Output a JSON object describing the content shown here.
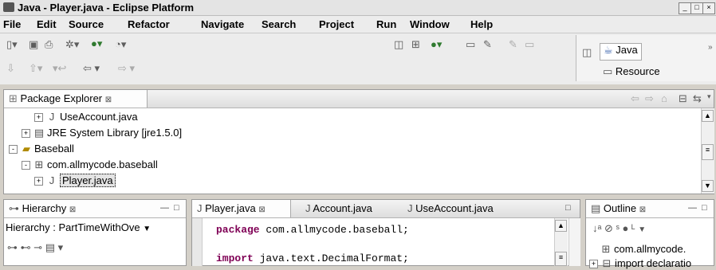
{
  "window": {
    "title": "Java - Player.java - Eclipse Platform"
  },
  "menu": [
    "File",
    "Edit",
    "Source",
    "Refactor",
    "Navigate",
    "Search",
    "Project",
    "Run",
    "Window",
    "Help"
  ],
  "perspectives": {
    "java": "Java",
    "resource": "Resource"
  },
  "package_explorer": {
    "tab": "Package Explorer",
    "tree": [
      {
        "label": "UseAccount.java",
        "expander": "+",
        "icon": "java-file-icon"
      },
      {
        "label": "JRE System Library [jre1.5.0]",
        "expander": "+",
        "icon": "library-icon"
      },
      {
        "label": "Baseball",
        "expander": "-",
        "icon": "project-folder-icon"
      },
      {
        "label": "com.allmycode.baseball",
        "expander": "-",
        "icon": "package-icon"
      },
      {
        "label": "Player.java",
        "expander": "+",
        "icon": "java-file-icon",
        "selected": true
      }
    ]
  },
  "hierarchy": {
    "tab": "Hierarchy",
    "selector": "Hierarchy : PartTimeWithOve"
  },
  "editor": {
    "tabs": [
      "Player.java",
      "Account.java",
      "UseAccount.java"
    ],
    "active_tab": "Player.java",
    "lines": [
      {
        "kw": "package",
        "rest": " com.allmycode.baseball;"
      },
      {
        "kw": "",
        "rest": ""
      },
      {
        "kw": "import",
        "rest": " java.text.DecimalFormat;"
      }
    ]
  },
  "outline": {
    "tab": "Outline",
    "items": [
      "com.allmycode.",
      "import declaratio"
    ]
  }
}
